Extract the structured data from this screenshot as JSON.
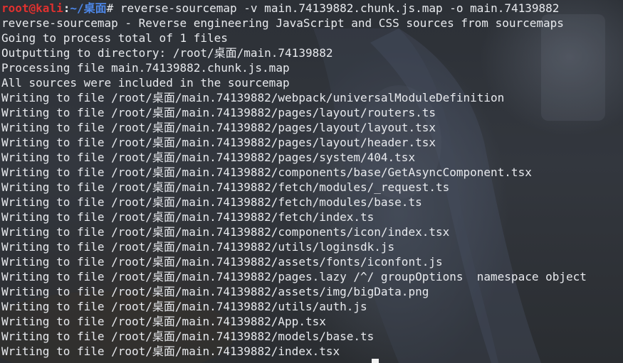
{
  "prompt": {
    "user_host": "root@kali",
    "separator": ":",
    "path": "~/桌面",
    "symbol": "# "
  },
  "command": "reverse-sourcemap -v main.74139882.chunk.js.map -o main.74139882",
  "output": [
    "reverse-sourcemap - Reverse engineering JavaScript and CSS sources from sourcemaps",
    "Going to process total of 1 files",
    "Outputting to directory: /root/桌面/main.74139882",
    "Processing file main.74139882.chunk.js.map",
    "All sources were included in the sourcemap",
    "Writing to file /root/桌面/main.74139882/webpack/universalModuleDefinition",
    "Writing to file /root/桌面/main.74139882/pages/layout/routers.ts",
    "Writing to file /root/桌面/main.74139882/pages/layout/layout.tsx",
    "Writing to file /root/桌面/main.74139882/pages/layout/header.tsx",
    "Writing to file /root/桌面/main.74139882/pages/system/404.tsx",
    "Writing to file /root/桌面/main.74139882/components/base/GetAsyncComponent.tsx",
    "Writing to file /root/桌面/main.74139882/fetch/modules/_request.ts",
    "Writing to file /root/桌面/main.74139882/fetch/modules/base.ts",
    "Writing to file /root/桌面/main.74139882/fetch/index.ts",
    "Writing to file /root/桌面/main.74139882/components/icon/index.tsx",
    "Writing to file /root/桌面/main.74139882/utils/loginsdk.js",
    "Writing to file /root/桌面/main.74139882/assets/fonts/iconfont.js",
    "Writing to file /root/桌面/main.74139882/pages.lazy /^/ groupOptions  namespace object",
    "Writing to file /root/桌面/main.74139882/assets/img/bigData.png",
    "Writing to file /root/桌面/main.74139882/utils/auth.js",
    "Writing to file /root/桌面/main.74139882/App.tsx",
    "Writing to file /root/桌面/main.74139882/models/base.ts",
    "Writing to file /root/桌面/main.74139882/index.tsx"
  ],
  "colors": {
    "background": "#2b2f35",
    "text": "#e8eaee",
    "prompt_user": "#e0312f",
    "prompt_path": "#4d87e8",
    "cursor": "#f2f2f2"
  }
}
